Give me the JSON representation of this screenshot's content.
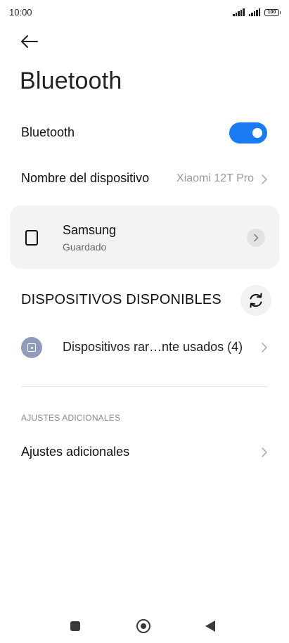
{
  "status_bar": {
    "time": "10:00",
    "battery": "100",
    "signal_icon": "signal-icon",
    "battery_icon": "battery-icon"
  },
  "header": {
    "back_icon": "arrow-left-icon",
    "title": "Bluetooth"
  },
  "bluetooth_toggle": {
    "label": "Bluetooth",
    "enabled": true,
    "accent_color": "#1a7bf2"
  },
  "device_name": {
    "label": "Nombre del dispositivo",
    "value": "Xiaomi 12T Pro"
  },
  "saved_device": {
    "name": "Samsung",
    "status": "Guardado",
    "icon": "phone-icon",
    "detail_icon": "chevron-right-icon"
  },
  "available_devices": {
    "header": "DISPOSITIVOS DISPONIBLES",
    "refresh_icon": "refresh-icon",
    "rare_devices_label": "Dispositivos rar…nte usados (4)",
    "rare_devices_icon": "device-icon"
  },
  "additional": {
    "section_header": "AJUSTES ADICIONALES",
    "label": "Ajustes adicionales"
  },
  "nav": {
    "recents_icon": "recents-icon",
    "home_icon": "home-icon",
    "back_icon": "back-triangle-icon"
  }
}
